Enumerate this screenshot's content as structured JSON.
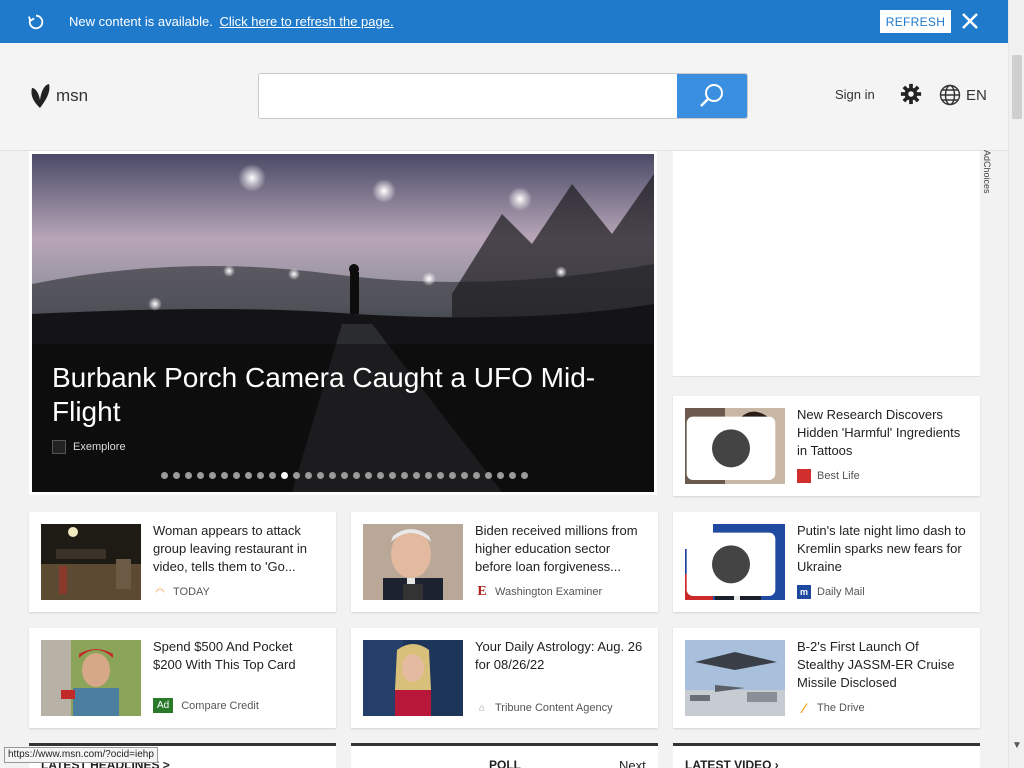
{
  "notification": {
    "message": "New content is available.",
    "link": "Click here to refresh the page.",
    "button": "REFRESH"
  },
  "header": {
    "logo_text": "msn",
    "search_placeholder": "",
    "sign_in": "Sign in",
    "language": "EN"
  },
  "hero": {
    "title": "Burbank Porch Camera Caught a UFO Mid-Flight",
    "source": "Exemplore",
    "slide_count": 31,
    "active_slide": 10
  },
  "ad_choices": "AdChoices",
  "cards": [
    {
      "title": "New Research Discovers Hidden 'Harmful' Ingredients in Tattoos",
      "source": "Best Life",
      "gallery": true
    },
    {
      "title": "Woman appears to attack group leaving restaurant in video, tells them to 'Go...",
      "source": "TODAY",
      "gallery": false
    },
    {
      "title": "Biden received millions from higher education sector before loan forgiveness...",
      "source": "Washington Examiner",
      "gallery": false
    },
    {
      "title": "Putin's late night limo dash to Kremlin sparks new fears for Ukraine",
      "source": "Daily Mail",
      "gallery": true
    },
    {
      "title": "Spend $500 And Pocket $200 With This Top Card",
      "source": "Compare Credit",
      "ad_label": "Ad",
      "gallery": false
    },
    {
      "title": "Your Daily Astrology: Aug. 26 for 08/26/22",
      "source": "Tribune Content Agency",
      "gallery": false
    },
    {
      "title": "B-2's First Launch Of Stealthy JASSM-ER Cruise Missile Disclosed",
      "source": "The Drive",
      "gallery": false
    }
  ],
  "sections": {
    "latest_headlines": "LATEST HEADLINES >",
    "poll": "POLL",
    "next": "Next",
    "latest_video": "LATEST VIDEO"
  },
  "status_url": "https://www.msn.com/?ocid=iehp",
  "colors": {
    "accent": "#1f7acc",
    "search_button": "#3b8fe0"
  }
}
